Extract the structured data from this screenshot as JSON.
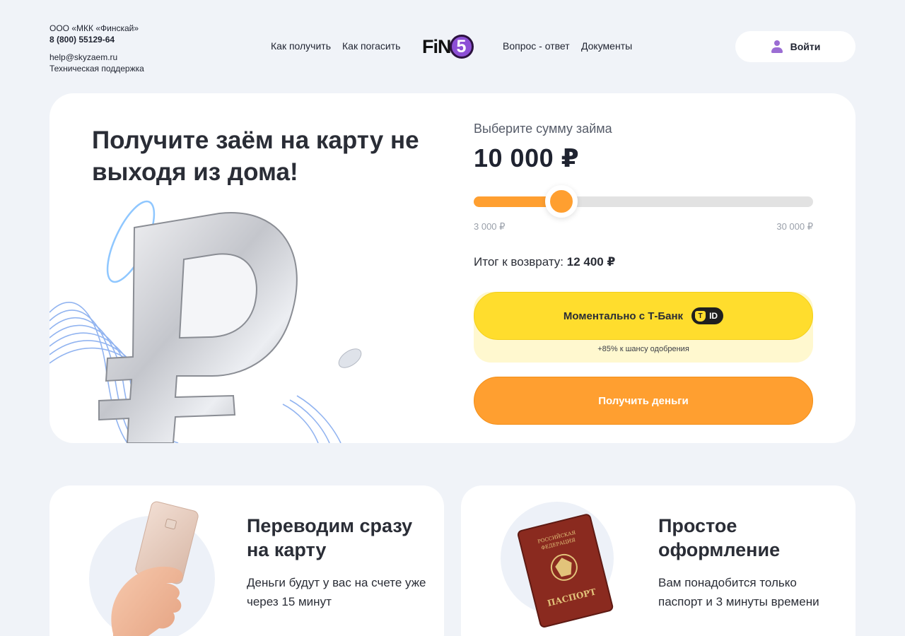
{
  "header": {
    "company": "ООО «МКК «Финскай»",
    "phone": "8 (800) 55129-64",
    "email": "help@skyzaem.ru",
    "support": "Техническая поддержка",
    "nav": {
      "how_to_get": "Как получить",
      "how_to_repay": "Как погасить",
      "faq": "Вопрос - ответ",
      "documents": "Документы"
    },
    "logo_text": "FiN",
    "logo_digit": "5",
    "login": "Войти"
  },
  "hero": {
    "title": "Получите заём на карту не выходя из дома!",
    "calc": {
      "label": "Выберите сумму займа",
      "amount": "10 000 ₽",
      "min_label": "3 000 ₽",
      "max_label": "30 000 ₽",
      "slider_min": 3000,
      "slider_max": 30000,
      "slider_value": 10000,
      "total_label": "Итог к возврату:",
      "total_value": "12 400 ₽"
    },
    "tbank_button": "Моментально с Т-Банк",
    "tbank_badge": "ID",
    "tbank_hint": "+85% к шансу одобрения",
    "get_money_button": "Получить деньги"
  },
  "features": [
    {
      "title": "Переводим сразу на карту",
      "text": "Деньги будут у вас на счете уже через 15 минут"
    },
    {
      "title": "Простое оформление",
      "text": "Вам понадобится только паспорт и 3 минуты времени"
    }
  ],
  "passport_cover": {
    "line1": "РОССИЙСКАЯ",
    "line2": "ФЕДЕРАЦИЯ",
    "word": "ПАСПОРТ"
  },
  "colors": {
    "background": "#f0f3f8",
    "accent_orange": "#ff9f30",
    "tbank_yellow": "#ffdd2d",
    "logo_purple": "#8d4fd6"
  }
}
